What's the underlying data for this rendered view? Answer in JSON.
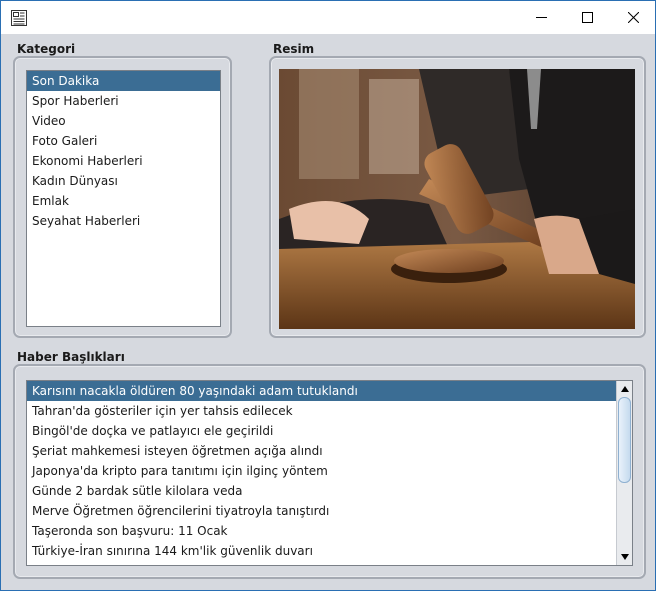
{
  "titlebar": {
    "icon": "app-icon",
    "controls": {
      "minimize": "minimize-icon",
      "maximize": "maximize-icon",
      "close": "close-icon"
    }
  },
  "kategori": {
    "title": "Kategori",
    "items": [
      "Son Dakika",
      "Spor Haberleri",
      "Video",
      "Foto Galeri",
      "Ekonomi Haberleri",
      "Kadın Dünyası",
      "Emlak",
      "Seyahat Haberleri"
    ],
    "selected_index": 0
  },
  "resim": {
    "title": "Resim"
  },
  "haber": {
    "title": "Haber Başlıkları",
    "items": [
      "Karısını nacakla öldüren 80 yaşındaki adam tutuklandı",
      "Tahran'da gösteriler için yer tahsis edilecek",
      "Bingöl'de doçka ve patlayıcı ele geçirildi",
      "Şeriat mahkemesi isteyen öğretmen açığa alındı",
      "Japonya'da kripto para tanıtımı için ilginç yöntem",
      "Günde 2 bardak sütle kilolara veda",
      "Merve Öğretmen öğrencilerini tiyatroyla tanıştırdı",
      "Taşeronda son başvuru: 11 Ocak",
      "Türkiye-İran sınırına 144 km'lik güvenlik duvarı"
    ],
    "selected_index": 0
  },
  "colors": {
    "selection": "#3b6d94",
    "background": "#d6d9df",
    "window_border": "#2a6fb3"
  }
}
